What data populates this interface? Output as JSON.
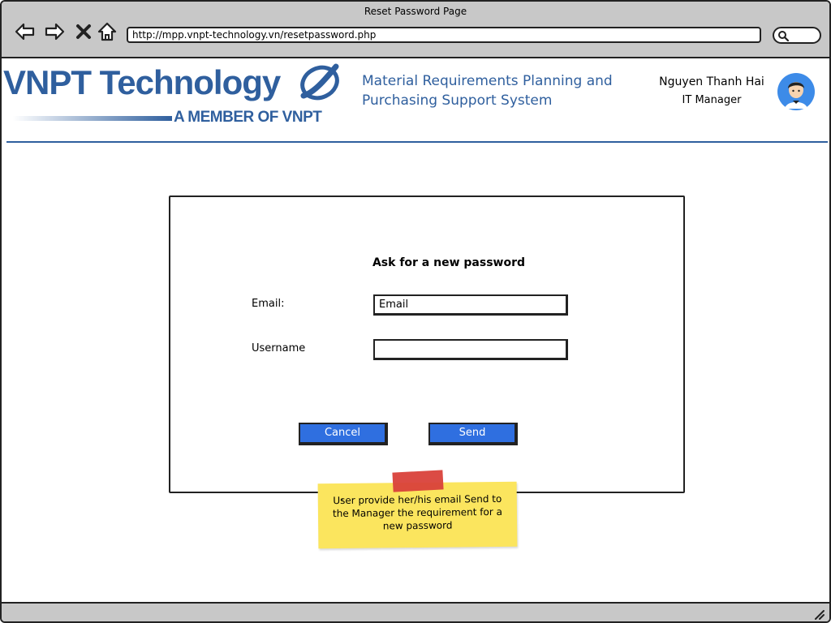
{
  "window": {
    "title": "Reset Password Page"
  },
  "browser": {
    "url": "http://mpp.vnpt-technology.vn/resetpassword.php",
    "nav_icons": [
      "back-arrow-icon",
      "forward-arrow-icon",
      "close-x-icon",
      "home-icon",
      "search-icon"
    ]
  },
  "header": {
    "logo_main": "VNPT Technology",
    "logo_sub": "A MEMBER OF VNPT",
    "system_title_line1": "Material Requirements Planning and",
    "system_title_line2": "Purchasing Support System",
    "user_name": "Nguyen Thanh Hai",
    "user_role": "IT Manager",
    "brand_color": "#2f5f9e"
  },
  "form": {
    "title": "Ask for a new password",
    "email_label": "Email:",
    "email_value": "Email",
    "username_label": "Username",
    "username_value": "",
    "cancel_label": "Cancel",
    "send_label": "Send",
    "button_color": "#2f6fe0"
  },
  "note": {
    "bullet": "·",
    "text": "User provide her/his email Send to the Manager the requirement for a new password",
    "background": "#fbe55e",
    "tape_color": "#d9413a"
  }
}
